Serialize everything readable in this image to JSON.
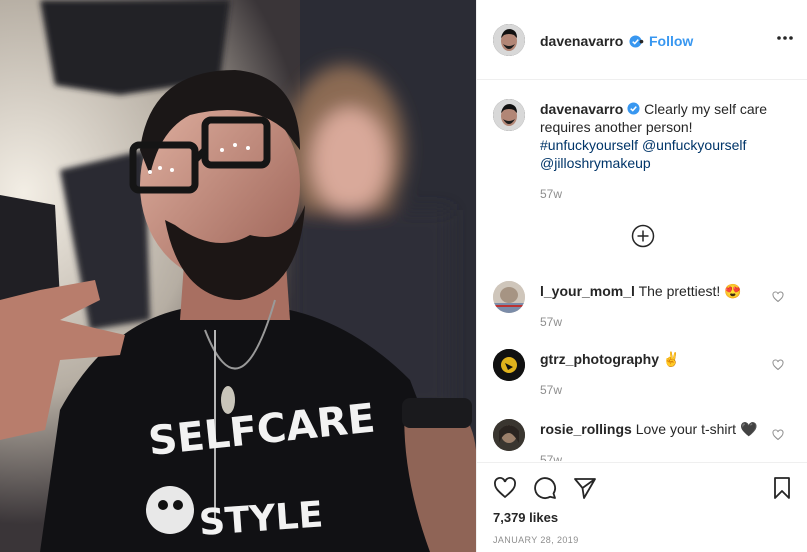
{
  "post": {
    "image_alt": "Selfie of a man with glasses and beard wearing a black t-shirt",
    "shirt_text_top": "SELFCARE",
    "shirt_text_bottom": "STYLE"
  },
  "header": {
    "username": "davenavarro",
    "separator": "•",
    "follow_label": "Follow",
    "more_icon": "more-horizontal-icon"
  },
  "caption": {
    "username": "davenavarro",
    "text": "Clearly my self care requires another person!",
    "tags": [
      "#unfuckyourself",
      "@unfuckyourself",
      "@jilloshrymakeup"
    ],
    "time": "57w"
  },
  "comments": [
    {
      "username": "l_your_mom_l",
      "text": "The prettiest!",
      "emoji": "😍",
      "time": "57w"
    },
    {
      "username": "gtrz_photography",
      "text": "",
      "emoji": "✌",
      "time": "57w"
    },
    {
      "username": "rosie_rollings",
      "text": "Love your t-shirt",
      "emoji": "🖤",
      "time": "57w"
    }
  ],
  "actions": {
    "likes": "7,379 likes",
    "date": "JANUARY 28, 2019",
    "icons": [
      "heart-icon",
      "comment-icon",
      "share-icon",
      "bookmark-icon"
    ]
  },
  "colors": {
    "link": "#003569",
    "follow": "#3897f0",
    "verified": "#3897f0",
    "muted": "#8e8e8e",
    "border": "#efefef"
  }
}
